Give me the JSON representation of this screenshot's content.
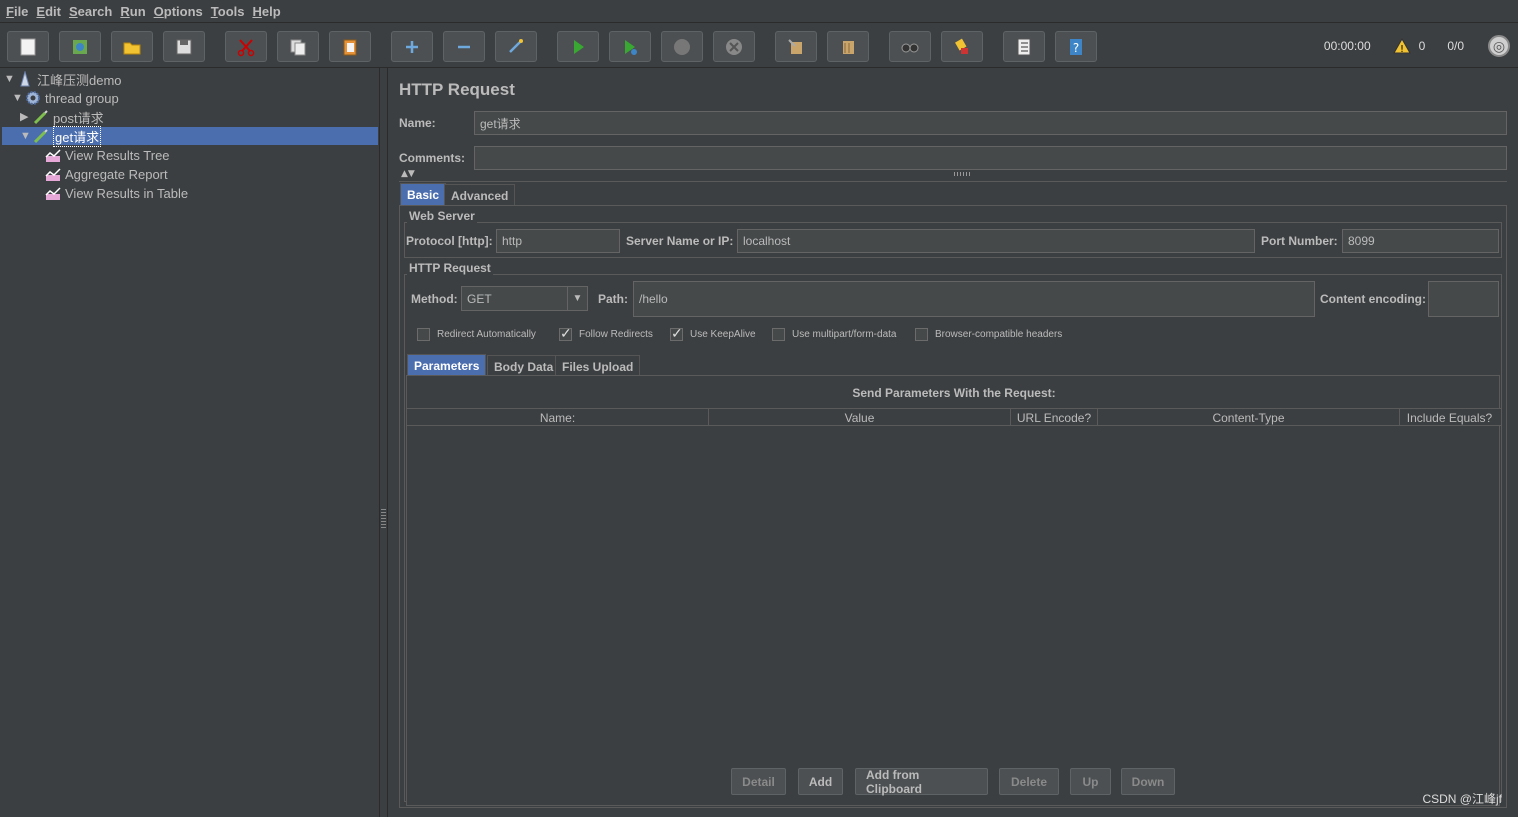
{
  "menu": [
    {
      "mnemonic": "F",
      "rest": "ile"
    },
    {
      "mnemonic": "E",
      "rest": "dit"
    },
    {
      "mnemonic": "S",
      "rest": "earch"
    },
    {
      "mnemonic": "R",
      "rest": "un"
    },
    {
      "mnemonic": "O",
      "rest": "ptions"
    },
    {
      "mnemonic": "T",
      "rest": "ools"
    },
    {
      "mnemonic": "H",
      "rest": "elp"
    }
  ],
  "toolbar": {
    "icons": [
      "new-icon",
      "templates-icon",
      "open-icon",
      "save-icon",
      "cut-icon",
      "copy-icon",
      "paste-icon",
      "expand-icon",
      "collapse-icon",
      "toggle-icon",
      "start-icon",
      "start-no-pauses-icon",
      "stop-icon",
      "shutdown-icon",
      "clear-icon",
      "clear-all-icon",
      "search-icon",
      "reset-search-icon",
      "function-helper-icon",
      "help-icon"
    ],
    "timer": "00:00:00",
    "warning_count": "0",
    "threads": "0/0"
  },
  "tree": {
    "plan": "江峰压测demo",
    "thread_group": "thread group",
    "post_sampler": "post请求",
    "get_sampler": "get请求",
    "listeners": [
      "View Results Tree",
      "Aggregate Report",
      "View Results in Table"
    ]
  },
  "panel": {
    "title": "HTTP Request",
    "name_label": "Name:",
    "name_value": "get请求",
    "comments_label": "Comments:",
    "comments_value": "",
    "tabs": [
      "Basic",
      "Advanced"
    ],
    "web_server": {
      "title": "Web Server",
      "protocol_label": "Protocol [http]:",
      "protocol_value": "http",
      "server_label": "Server Name or IP:",
      "server_value": "localhost",
      "port_label": "Port Number:",
      "port_value": "8099"
    },
    "http_request": {
      "title": "HTTP Request",
      "method_label": "Method:",
      "method_value": "GET",
      "path_label": "Path:",
      "path_value": "/hello",
      "encoding_label": "Content encoding:",
      "encoding_value": ""
    },
    "checkboxes": [
      {
        "label": "Redirect Automatically",
        "checked": false
      },
      {
        "label": "Follow Redirects",
        "checked": true
      },
      {
        "label": "Use KeepAlive",
        "checked": true
      },
      {
        "label": "Use multipart/form-data",
        "checked": false
      },
      {
        "label": "Browser-compatible headers",
        "checked": false
      }
    ],
    "sub_tabs": [
      "Parameters",
      "Body Data",
      "Files Upload"
    ],
    "params_caption": "Send Parameters With the Request:",
    "columns": [
      "Name:",
      "Value",
      "URL Encode?",
      "Content-Type",
      "Include Equals?"
    ],
    "buttons": {
      "detail": "Detail",
      "add": "Add",
      "add_clipboard": "Add from Clipboard",
      "delete": "Delete",
      "up": "Up",
      "down": "Down"
    }
  },
  "watermark": "CSDN @江峰jf",
  "colors": {
    "selection": "#4b6eaf",
    "background": "#3c3f41",
    "field": "#45494a"
  }
}
